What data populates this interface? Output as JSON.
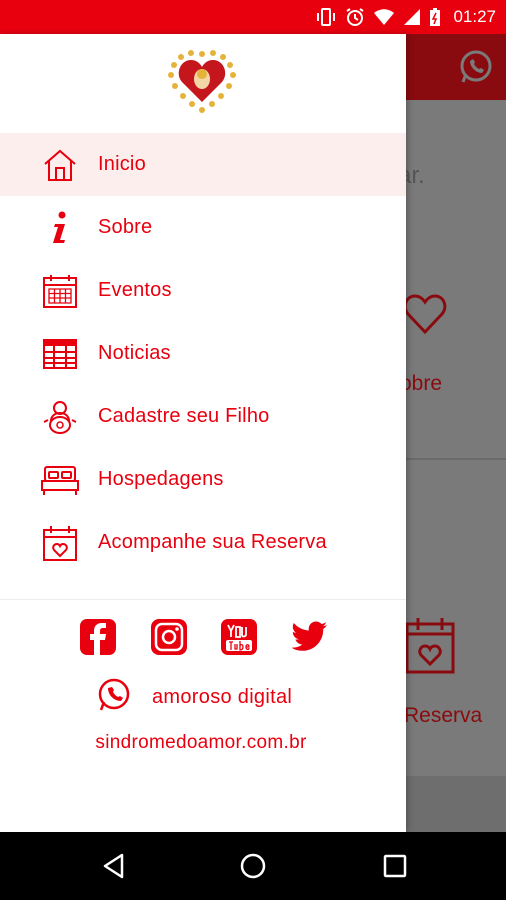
{
  "status_bar": {
    "time": "01:27",
    "icons": [
      "vibrate-icon",
      "alarm-icon",
      "wifi-icon",
      "signal-icon",
      "battery-icon"
    ]
  },
  "background_app": {
    "partial_text_1": "ar.",
    "partial_text_2": "obre",
    "partial_text_3": "Reserva"
  },
  "drawer": {
    "menu": [
      {
        "label": "Inicio",
        "icon": "home-icon"
      },
      {
        "label": "Sobre",
        "icon": "info-icon"
      },
      {
        "label": "Eventos",
        "icon": "calendar-icon"
      },
      {
        "label": "Noticias",
        "icon": "news-icon"
      },
      {
        "label": "Cadastre seu Filho",
        "icon": "baby-icon"
      },
      {
        "label": "Hospedagens",
        "icon": "bed-icon"
      },
      {
        "label": "Acompanhe sua Reserva",
        "icon": "calendar-heart-icon"
      }
    ],
    "social": [
      "facebook-icon",
      "instagram-icon",
      "youtube-icon",
      "twitter-icon"
    ],
    "whatsapp_label": "amoroso digital",
    "website": "sindromedoamor.com.br"
  },
  "colors": {
    "accent": "#e8000f",
    "active_bg": "#fdeeee"
  }
}
